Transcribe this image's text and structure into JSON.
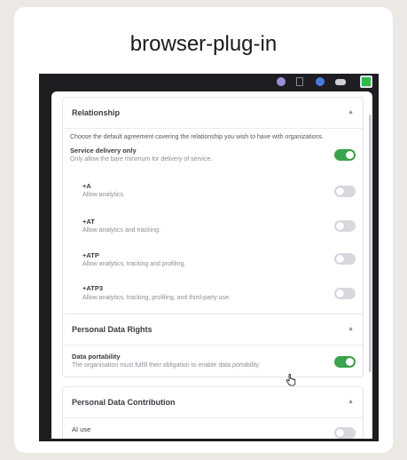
{
  "title": "browser-plug-in",
  "extension_bar": {
    "icons": [
      "privacy-extension-icon",
      "page-icon",
      "shield-icon",
      "puzzle-icon",
      "active-extension-icon"
    ]
  },
  "sections": {
    "relationship": {
      "title": "Relationship",
      "intro": "Choose the default agreement covering the relationship you wish to have with organizations.",
      "service": {
        "title": "Service delivery only",
        "desc": "Only allow the bare minimum for delivery of service.",
        "enabled": true
      },
      "options": [
        {
          "title": "+A",
          "desc": "Allow analytics.",
          "enabled": false
        },
        {
          "title": "+AT",
          "desc": "Allow analytics and tracking.",
          "enabled": false
        },
        {
          "title": "+ATP",
          "desc": "Allow analytics, tracking and profiling.",
          "enabled": false
        },
        {
          "title": "+ATP3",
          "desc": "Allow analytics, tracking, profiling, and third-party use.",
          "enabled": false
        }
      ]
    },
    "personal_data_rights": {
      "title": "Personal Data Rights",
      "portability": {
        "title": "Data portability",
        "desc": "The organisation must fulfill their obligation to enable data portability.",
        "enabled": true
      }
    },
    "personal_data_contribution": {
      "title": "Personal Data Contribution",
      "ai_use": {
        "title": "AI use",
        "enabled": false
      }
    }
  },
  "colors": {
    "toggle_on": "#3aa34d",
    "toggle_off": "#d8d8de",
    "screen_bg": "#1d1d22"
  }
}
